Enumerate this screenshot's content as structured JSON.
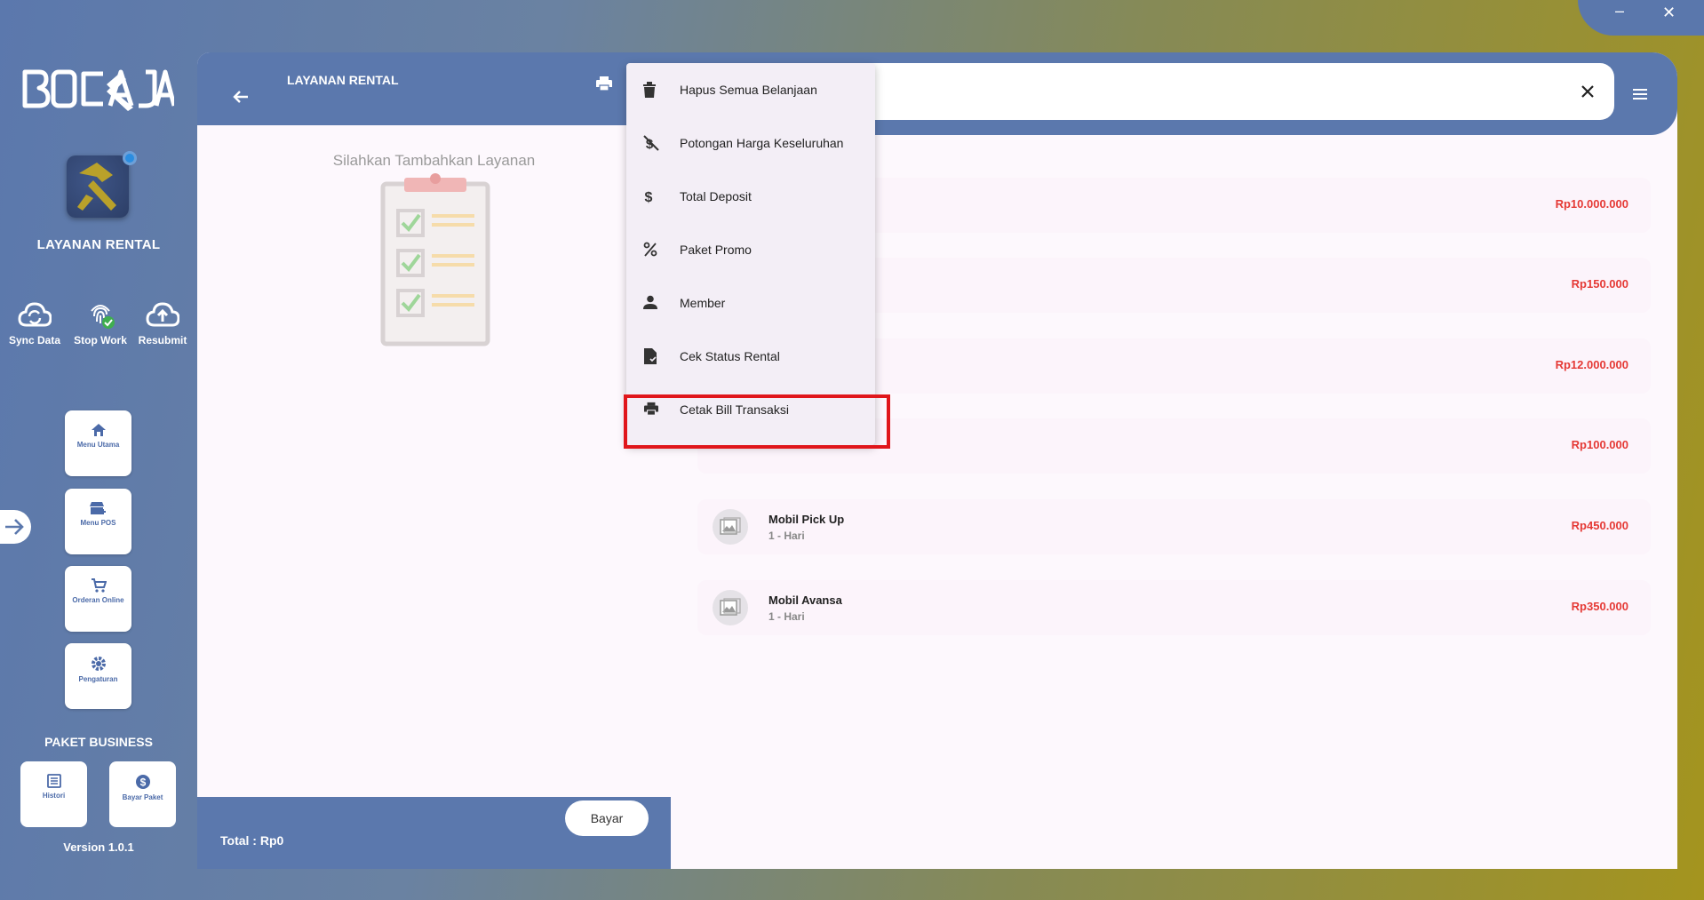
{
  "window": {
    "minimize_glyph": "–",
    "close_glyph": "✕"
  },
  "sidebar": {
    "brand": "BOC AJA",
    "title": "LAYANAN RENTAL",
    "actions": [
      {
        "label": "Sync Data",
        "icon": "cloud-sync-icon"
      },
      {
        "label": "Stop Work",
        "icon": "fingerprint-check-icon"
      },
      {
        "label": "Resubmit",
        "icon": "cloud-upload-icon"
      }
    ],
    "nav": [
      {
        "label": "Menu Utama",
        "icon": "home-icon"
      },
      {
        "label": "Menu POS",
        "icon": "store-add-icon"
      },
      {
        "label": "Orderan Online",
        "icon": "cart-icon"
      },
      {
        "label": "Pengaturan",
        "icon": "gear-icon"
      }
    ],
    "paket_title": "PAKET BUSINESS",
    "paket": [
      {
        "label": "Histori",
        "icon": "list-icon"
      },
      {
        "label": "Bayar Paket",
        "icon": "dollar-circle-icon"
      }
    ],
    "version": "Version 1.0.1"
  },
  "cart": {
    "title": "LAYANAN RENTAL",
    "empty_text": "Silahkan Tambahkan Layanan",
    "total_label": "Total :  Rp0",
    "pay_label": "Bayar"
  },
  "search": {
    "value": "",
    "placeholder": ""
  },
  "items": [
    {
      "name": "",
      "unit": "",
      "price": "Rp10.000.000"
    },
    {
      "name": "",
      "unit": "",
      "price": "Rp150.000"
    },
    {
      "name": "",
      "unit": "",
      "price": "Rp12.000.000"
    },
    {
      "name": "",
      "unit": "",
      "price": "Rp100.000"
    },
    {
      "name": "Mobil Pick Up",
      "unit": "1 - Hari",
      "price": "Rp450.000"
    },
    {
      "name": "Mobil Avansa",
      "unit": "1 - Hari",
      "price": "Rp350.000"
    }
  ],
  "menu": [
    {
      "label": "Hapus Semua Belanjaan",
      "icon": "trash-icon"
    },
    {
      "label": "Potongan Harga Keseluruhan",
      "icon": "money-off-icon"
    },
    {
      "label": "Total Deposit",
      "icon": "dollar-icon"
    },
    {
      "label": "Paket Promo",
      "icon": "percent-icon"
    },
    {
      "label": "Member",
      "icon": "person-icon"
    },
    {
      "label": "Cek Status Rental",
      "icon": "file-check-icon"
    },
    {
      "label": "Cetak Bill Transaksi",
      "icon": "print-icon"
    }
  ],
  "colors": {
    "primary": "#5b78ad",
    "price": "#e53935",
    "highlight": "#e0161b",
    "panel": "#fdf8fd"
  }
}
